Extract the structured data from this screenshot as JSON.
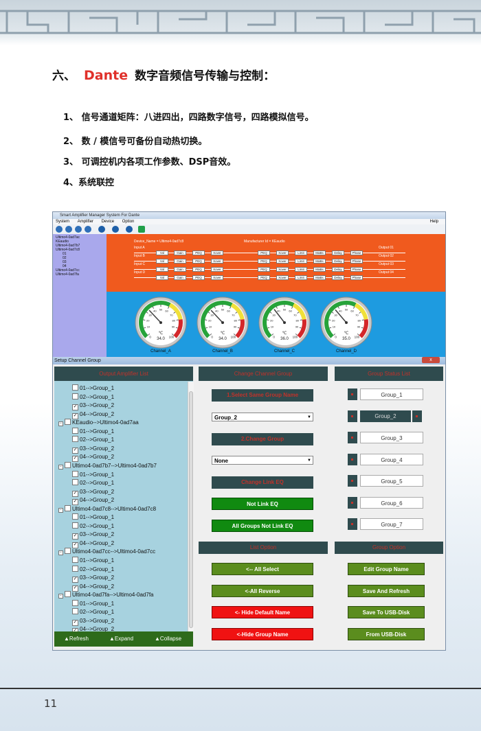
{
  "heading": {
    "num": "六、",
    "dante": "Dante",
    "rest": "数字音频信号传输与控制："
  },
  "items": [
    "1、 信号通道矩阵：八进四出，四路数字信号，四路模拟信号。",
    "2、 数 / 模信号可备份自动热切换。",
    "3、 可调控机内各项工作参数、DSP音效。",
    "4、系统联控"
  ],
  "page_number": "11",
  "app": {
    "title": "Smart Amplifier Manager System For Dante",
    "menu": [
      "System",
      "Amplifier",
      "Device",
      "Option"
    ],
    "help": "Help",
    "tree": [
      {
        "label": "Ultimo4-0ad7ac",
        "sub": false
      },
      {
        "label": "KEaudio",
        "sub": false
      },
      {
        "label": "Ultimo4-0ad7b7",
        "sub": false
      },
      {
        "label": "Ultimo4-0ad7c8",
        "sub": false
      },
      {
        "label": "01",
        "sub": true
      },
      {
        "label": "02",
        "sub": true
      },
      {
        "label": "03",
        "sub": true
      },
      {
        "label": "04",
        "sub": true
      },
      {
        "label": "Ultimo4-0ad7cc",
        "sub": false
      },
      {
        "label": "Ultimo4-0ad7fa",
        "sub": false
      }
    ],
    "device_name": "Device_Name = Ultimo4-0ad7c8",
    "manufacturer": "Manufacturer Id = KEaudio",
    "inputs": [
      "Input A",
      "Input B",
      "Input C",
      "Input D"
    ],
    "outputs": [
      "Output 01",
      "Output 02",
      "Output 03",
      "Output 04"
    ],
    "in_blocks": [
      "Vol",
      "Gain",
      "PEQ",
      "Xover"
    ],
    "out_blocks": [
      "PEQ",
      "Xover",
      "Limit",
      "MaBs",
      "Delay",
      "Phase"
    ],
    "gauges": [
      {
        "label": "Channel_A",
        "value": "34.0",
        "level": 34
      },
      {
        "label": "Channel_B",
        "value": "34.0",
        "level": 34
      },
      {
        "label": "Channel_C",
        "value": "36.0",
        "level": 36
      },
      {
        "label": "Channel_D",
        "value": "35.0",
        "level": 35
      }
    ],
    "gauge_unit": "℃",
    "gauge_min": "0",
    "gauge_max": "100",
    "gauge_ticks": [
      "10",
      "20",
      "30",
      "40",
      "50",
      "60",
      "70",
      "80",
      "90"
    ],
    "colors": {
      "orange": "#f05a1e",
      "blue": "#1e9be0",
      "tree": "#a9a8ec",
      "panel": "#a7d2df"
    }
  },
  "dialog": {
    "title": "Setup Channel Group",
    "close": "x",
    "headers": {
      "list": "Output Amplifier List",
      "change": "Change Channel Group",
      "status": "Group Status List",
      "list_option": "List Option",
      "group_option": "Group Option"
    },
    "rows": [
      {
        "type": "ch",
        "text": "01-->Group_1",
        "checked": false
      },
      {
        "type": "ch",
        "text": "02-->Group_1",
        "checked": false
      },
      {
        "type": "ch",
        "text": "03-->Group_2",
        "checked": true
      },
      {
        "type": "ch",
        "text": "04-->Group_2",
        "checked": true
      },
      {
        "type": "dev",
        "text": "KEaudio-->Ultimo4-0ad7aa"
      },
      {
        "type": "ch",
        "text": "01-->Group_1",
        "checked": false
      },
      {
        "type": "ch",
        "text": "02-->Group_1",
        "checked": false
      },
      {
        "type": "ch",
        "text": "03-->Group_2",
        "checked": true
      },
      {
        "type": "ch",
        "text": "04-->Group_2",
        "checked": true
      },
      {
        "type": "dev",
        "text": "Ultimo4-0ad7b7-->Ultimo4-0ad7b7"
      },
      {
        "type": "ch",
        "text": "01-->Group_1",
        "checked": false
      },
      {
        "type": "ch",
        "text": "02-->Group_1",
        "checked": false
      },
      {
        "type": "ch",
        "text": "03-->Group_2",
        "checked": true
      },
      {
        "type": "ch",
        "text": "04-->Group_2",
        "checked": true
      },
      {
        "type": "dev",
        "text": "Ultimo4-0ad7c8-->Ultimo4-0ad7c8"
      },
      {
        "type": "ch",
        "text": "01-->Group_1",
        "checked": false
      },
      {
        "type": "ch",
        "text": "02-->Group_1",
        "checked": false
      },
      {
        "type": "ch",
        "text": "03-->Group_2",
        "checked": true
      },
      {
        "type": "ch",
        "text": "04-->Group_2",
        "checked": true
      },
      {
        "type": "dev",
        "text": "Ultimo4-0ad7cc-->Ultimo4-0ad7cc"
      },
      {
        "type": "ch",
        "text": "01-->Group_1",
        "checked": false
      },
      {
        "type": "ch",
        "text": "02-->Group_1",
        "checked": false
      },
      {
        "type": "ch",
        "text": "03-->Group_2",
        "checked": true
      },
      {
        "type": "ch",
        "text": "04-->Group_2",
        "checked": true
      },
      {
        "type": "dev",
        "text": "Ultimo4-0ad7fa-->Ultimo4-0ad7fa"
      },
      {
        "type": "ch",
        "text": "01-->Group_1",
        "checked": false
      },
      {
        "type": "ch",
        "text": "02-->Group_1",
        "checked": false
      },
      {
        "type": "ch",
        "text": "03-->Group_2",
        "checked": true
      },
      {
        "type": "ch",
        "text": "04-->Group_2",
        "checked": true
      }
    ],
    "bottom": {
      "refresh": "▲Refresh",
      "expand": "▲Expand",
      "collapse": "▲Collapse"
    },
    "change": {
      "select_label": "1.Select Same Group Name",
      "select_value": "Group_2",
      "change_group": "2.Change Group",
      "none_value": "None",
      "change_link": "Change Link EQ",
      "not_link": "Not Link EQ",
      "all_not_link": "All Groups Not Link EQ"
    },
    "groups": [
      "Group_1",
      "Group_2",
      "Group_3",
      "Group_4",
      "Group_5",
      "Group_6",
      "Group_7"
    ],
    "list_buttons": [
      "<-- All Select",
      "<-All Reverse",
      "<- Hide Default Name",
      "<-Hide Group Name"
    ],
    "group_buttons": [
      "Edit Group Name",
      "Save And Refresh",
      "Save To USB-Disk",
      "From USB-Disk"
    ]
  }
}
